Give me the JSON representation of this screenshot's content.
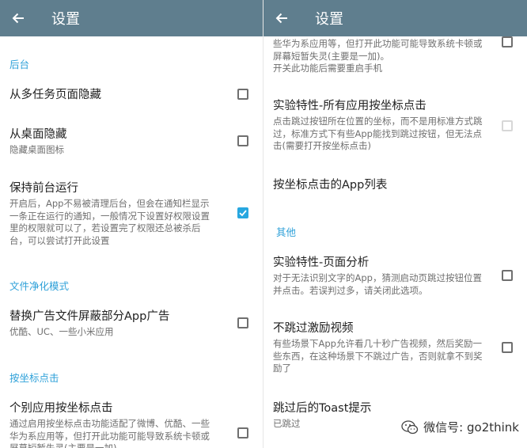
{
  "left": {
    "title": "设置",
    "sections": {
      "background": "后台",
      "file_clean": "文件净化模式",
      "coord_click": "按坐标点击"
    },
    "items": {
      "hide_recents": {
        "title": "从多任务页面隐藏",
        "checked": false
      },
      "hide_desktop": {
        "title": "从桌面隐藏",
        "desc": "隐藏桌面图标",
        "checked": false
      },
      "keep_foreground": {
        "title": "保持前台运行",
        "desc": "开启后，App不易被清理后台，但会在通知栏显示一条正在运行的通知，一般情况下设置好权限设置里的权限就可以了，若设置完了权限还总被杀后台，可以尝试打开此设置",
        "checked": true
      },
      "replace_ads": {
        "title": "替换广告文件屏蔽部分App广告",
        "desc": "优酷、UC、一些小米应用",
        "checked": false
      },
      "coord_click_some": {
        "title": "个别应用按坐标点击",
        "desc": "通过启用按坐标点击功能适配了微博、优酷、一些华为系应用等，但打开此功能可能导致系统卡顿或屏幕短暂失灵(主要是一加)",
        "checked": false
      }
    }
  },
  "right": {
    "title": "设置",
    "partial_desc": "些华为系应用等，但打开此功能可能导致系统卡顿或屏幕短暂失灵(主要是一加)。\n开关此功能后需要重启手机",
    "sections": {
      "other": "其他"
    },
    "items": {
      "exp_all_coord": {
        "title": "实验特性-所有应用按坐标点击",
        "desc": "点击跳过按钮所在位置的坐标，而不是用标准方式跳过，标准方式下有些App能找到跳过按钮，但无法点击(需要打开按坐标点击)",
        "checked": false,
        "disabled": true
      },
      "coord_app_list": {
        "title": "按坐标点击的App列表"
      },
      "page_analysis": {
        "title": "实验特性-页面分析",
        "desc": "对于无法识别文字的App，猜测启动页跳过按钮位置并点击。若误判过多，请关闭此选项。",
        "checked": false
      },
      "no_skip_reward": {
        "title": "不跳过激励视频",
        "desc": "有些场景下App允许看几十秒广告视频，然后奖励一些东西，在这种场景下不跳过广告，否则就拿不到奖励了",
        "checked": false
      },
      "toast": {
        "title": "跳过后的Toast提示",
        "desc": "已跳过"
      }
    }
  },
  "watermark": {
    "text": "微信号: go2think"
  },
  "colors": {
    "toolbar": "#5f7e8e",
    "accent": "#27a7e0",
    "section": "#2fa1d9"
  }
}
